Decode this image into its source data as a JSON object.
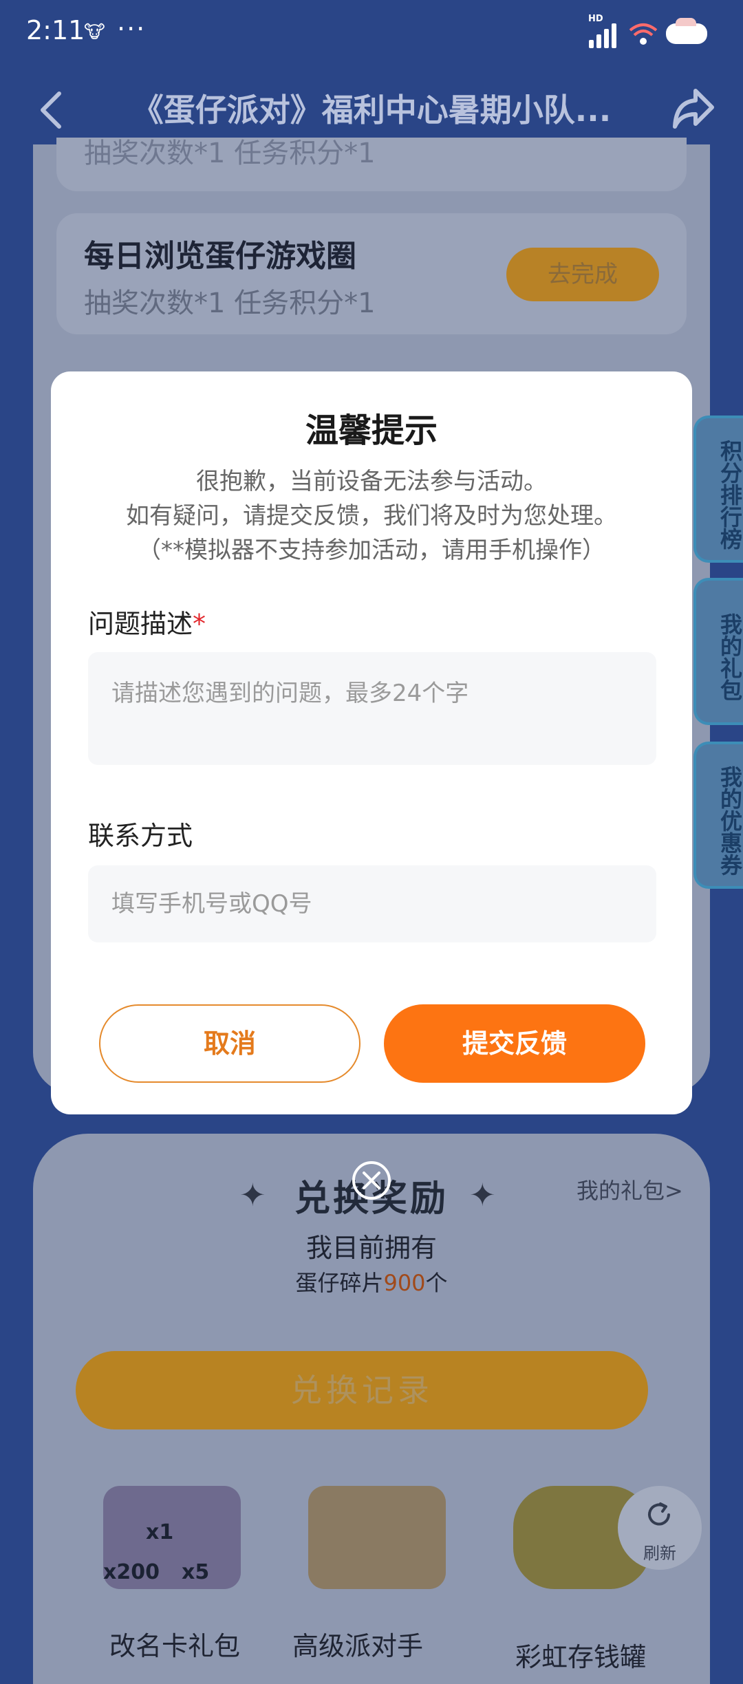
{
  "status_bar": {
    "time": "2:11",
    "app_icon_glyph": "🐮",
    "more_dots": "···",
    "hd_label": "HD"
  },
  "nav": {
    "title": "《蛋仔派对》福利中心暑期小队...",
    "back_icon": "chevron-left-icon",
    "share_icon": "share-icon"
  },
  "background": {
    "task_partial_text": "抽奖次数*1   任务积分*1",
    "task": {
      "title": "每日浏览蛋仔游戏圈",
      "sub": "抽奖次数*1    任务积分*1",
      "button": "去完成"
    },
    "side_tabs": [
      "积分排行榜",
      "我的礼包",
      "我的优惠券"
    ],
    "rewards": {
      "title": "兑换奖励",
      "my_gift_link": "我的礼包>",
      "own_label": "我目前拥有",
      "fragments_prefix": "蛋仔碎片",
      "fragments_count": "900",
      "fragments_suffix": "个",
      "history_button": "兑换记录",
      "prize_badges": [
        "x1",
        "x200",
        "x5"
      ],
      "prizes": [
        "改名卡礼包",
        "高级派对手",
        "彩虹存钱罐"
      ]
    },
    "refresh_label": "刷新"
  },
  "modal": {
    "title": "温馨提示",
    "lines": [
      "很抱歉，当前设备无法参与活动。",
      "如有疑问，请提交反馈，我们将及时为您处理。",
      "（**模拟器不支持参加活动，请用手机操作）"
    ],
    "desc_label": "问题描述",
    "required_mark": "*",
    "desc_placeholder": "请描述您遇到的问题，最多24个字",
    "contact_label": "联系方式",
    "contact_placeholder": "填写手机号或QQ号",
    "cancel": "取消",
    "submit": "提交反馈"
  },
  "colors": {
    "backdrop": "#2a4587",
    "accent": "#fd7412",
    "required": "#e2262b"
  }
}
